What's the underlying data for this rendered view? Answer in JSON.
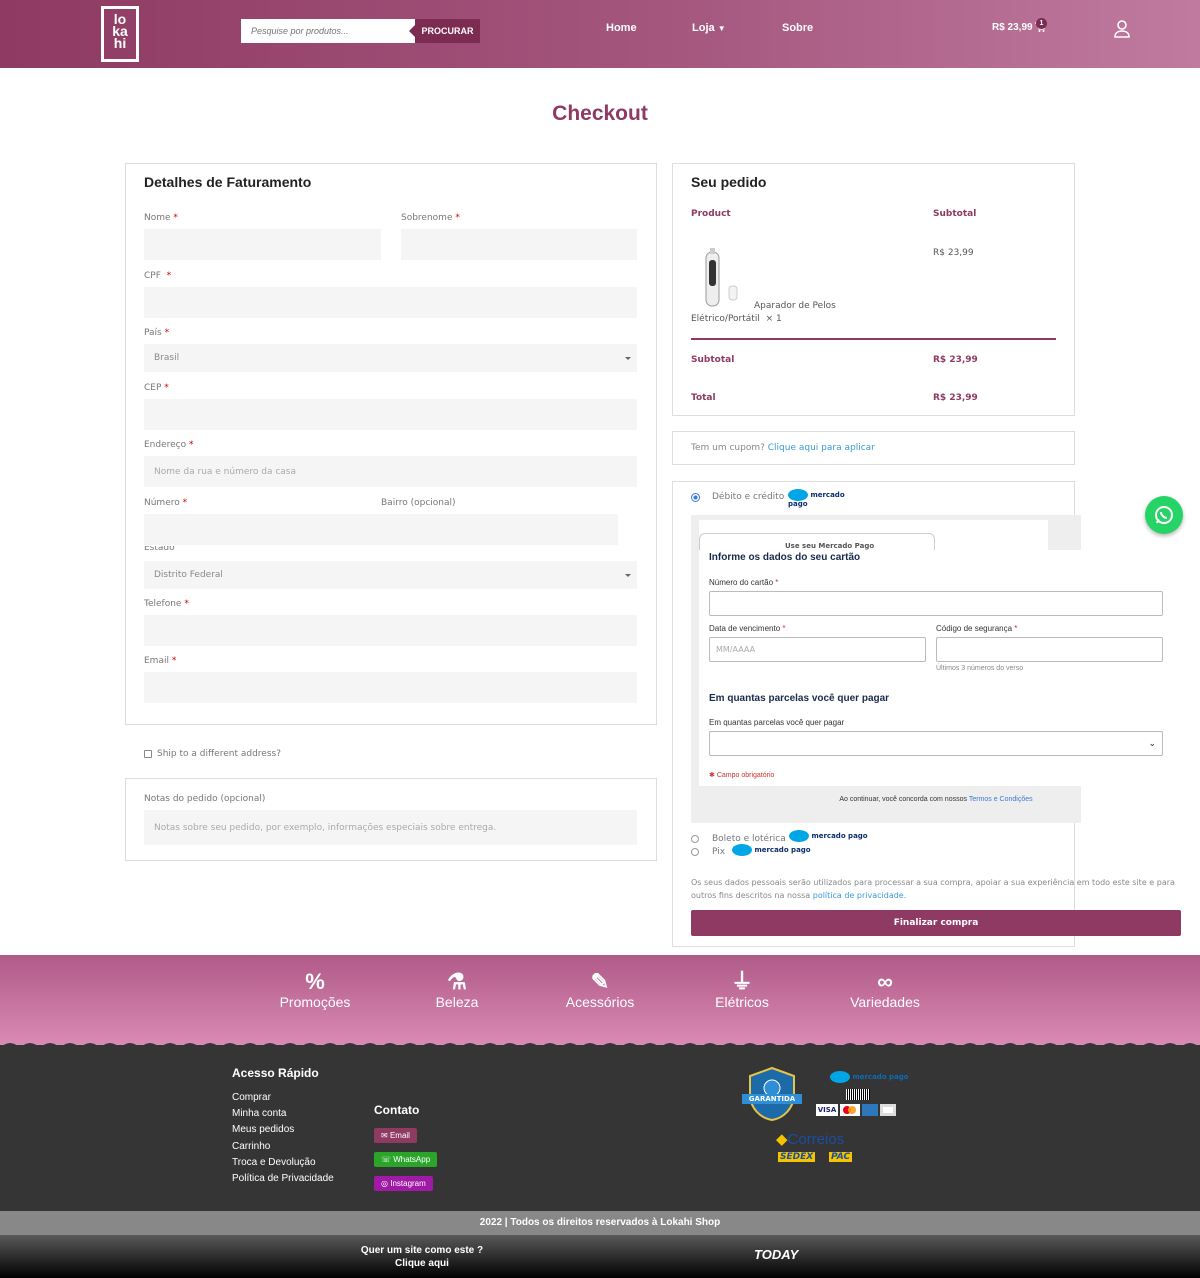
{
  "header": {
    "logo": "lokahi",
    "search_placeholder": "Pesquise por produtos...",
    "search_button": "PROCURAR",
    "nav": [
      "Home",
      "Loja",
      "Sobre"
    ],
    "cart_total": "R$ 23,99",
    "cart_count": "1"
  },
  "page_title": "Checkout",
  "billing": {
    "title": "Detalhes de Faturamento",
    "nome": "Nome",
    "sobrenome": "Sobrenome",
    "cpf": "CPF",
    "pais": "País",
    "pais_value": "Brasil",
    "cep": "CEP",
    "endereco": "Endereço",
    "endereco_ph": "Nome da rua e número da casa",
    "numero": "Número",
    "bairro": "Bairro (opcional)",
    "estado": "Estado",
    "estado_value": "Distrito Federal",
    "telefone": "Telefone",
    "email": "Email",
    "req": "*"
  },
  "ship_label": "Ship to a different address?",
  "notes": {
    "label": "Notas do pedido (opcional)",
    "placeholder": "Notas sobre seu pedido, por exemplo, informações especiais sobre entrega."
  },
  "order": {
    "title": "Seu pedido",
    "col_product": "Product",
    "col_subtotal": "Subtotal",
    "item_name_1": "Aparador de Pelos",
    "item_name_2": "Elétrico/Portátil",
    "item_qty": "× 1",
    "item_price": "R$ 23,99",
    "subtotal_label": "Subtotal",
    "subtotal": "R$ 23,99",
    "total_label": "Total",
    "total": "R$ 23,99"
  },
  "coupon": {
    "text": "Tem um cupom?",
    "link": "Clique aqui para aplicar"
  },
  "payment": {
    "debit": "Débito e crédito",
    "mp_logo": "mercado pago",
    "use_mp": "Use seu Mercado Pago",
    "form_title": "Informe os dados do seu cartão",
    "card_number": "Número do cartão",
    "expiry": "Data de vencimento",
    "expiry_ph": "MM/AAAA",
    "cvv": "Código de segurança",
    "cvv_hint": "Últimos 3 números do verso",
    "installments_title": "Em quantas parcelas você quer pagar",
    "installments_label": "Em quantas parcelas você quer pagar",
    "required": "Campo obrigatório",
    "terms_text": "Ao continuar, você concorda com nossos",
    "terms_link": "Termos e Condições",
    "boleto": "Boleto e lotérica",
    "pix": "Pix",
    "privacy_text": "Os seus dados pessoais serão utilizados para processar a sua compra, apoiar a sua experiência em todo este site e para outros fins descritos na nossa",
    "privacy_link": "política de privacidade.",
    "submit": "Finalizar compra"
  },
  "categories": [
    {
      "icon": "%",
      "label": "Promoções"
    },
    {
      "icon": "⚗",
      "label": "Beleza"
    },
    {
      "icon": "✎",
      "label": "Acessórios"
    },
    {
      "icon": "⏚",
      "label": "Elétricos"
    },
    {
      "icon": "∞",
      "label": "Variedades"
    }
  ],
  "footer": {
    "quick_title": "Acesso Rápido",
    "quick_links": [
      "Comprar",
      "Minha conta",
      "Meus pedidos",
      "Carrinho",
      "Troca e Devolução",
      "Política de Privacidade"
    ],
    "contact_title": "Contato",
    "contact": [
      "Email",
      "WhatsApp",
      "Instagram"
    ],
    "badge": "GARANTIDA",
    "mp": "mercado pago",
    "cards": [
      "VISA"
    ],
    "correios": "Correios",
    "sedex": "SEDEX",
    "pac": "PAC",
    "copyright": "2022 | Todos os direitos reservados à Lokahi Shop",
    "cta1": "Quer um site como este ?",
    "cta2": "Clique aqui",
    "brand": "TODAY"
  },
  "colors": {
    "brand": "#8e3a63",
    "whatsapp": "#25d366"
  }
}
